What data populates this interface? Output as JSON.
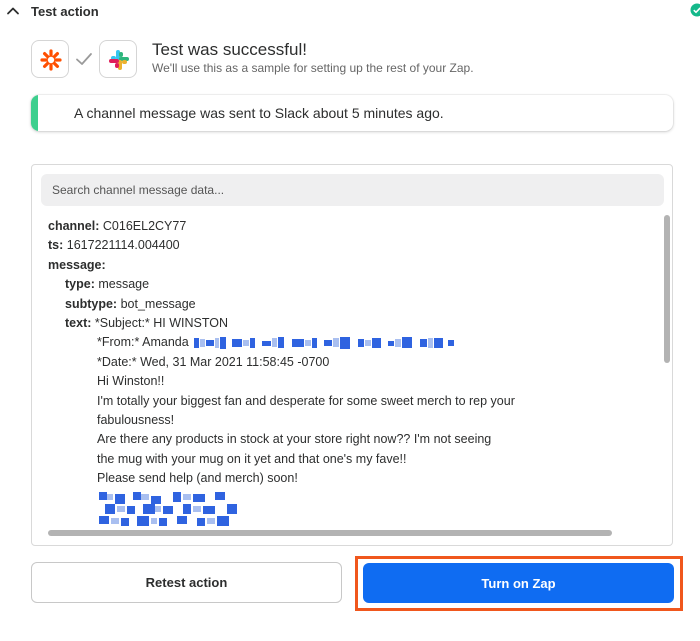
{
  "header": {
    "title": "Test action",
    "collapse_icon": "chevron-up-icon",
    "status_icon": "check-icon"
  },
  "apps": {
    "trigger_icon": "zapier-icon",
    "connector_icon": "check-icon",
    "action_icon": "slack-icon"
  },
  "result": {
    "title": "Test was successful!",
    "subtitle": "We'll use this as a sample for setting up the rest of your Zap."
  },
  "banner": {
    "text": "A channel message was sent to Slack about 5 minutes ago.",
    "accent_color": "#3ecf8e"
  },
  "search": {
    "placeholder": "Search channel message data..."
  },
  "data": {
    "channel": {
      "key": "channel:",
      "value": "C016EL2CY77"
    },
    "ts": {
      "key": "ts:",
      "value": "1617221114.004400"
    },
    "message": {
      "key": "message:"
    },
    "type": {
      "key": "type:",
      "value": "message"
    },
    "subtype": {
      "key": "subtype:",
      "value": "bot_message"
    },
    "text": {
      "key": "text:",
      "lines": [
        "*Subject:* HI WINSTON",
        "*From:* Amanda",
        "*Date:* Wed, 31 Mar 2021 11:58:45 -0700",
        "Hi Winston!!",
        "I'm totally your biggest fan and desperate for some sweet merch to rep your",
        "fabulousness!",
        "Are there any products in stock at your store right now?? I'm not seeing",
        "the mug with your mug on it yet and that one's my fave!!",
        "Please send help (and merch) soon!"
      ]
    }
  },
  "buttons": {
    "retest": "Retest action",
    "turn_on": "Turn on Zap"
  },
  "colors": {
    "primary": "#0f6cf2",
    "highlight": "#f0571d",
    "zapier": "#ff4f00"
  }
}
